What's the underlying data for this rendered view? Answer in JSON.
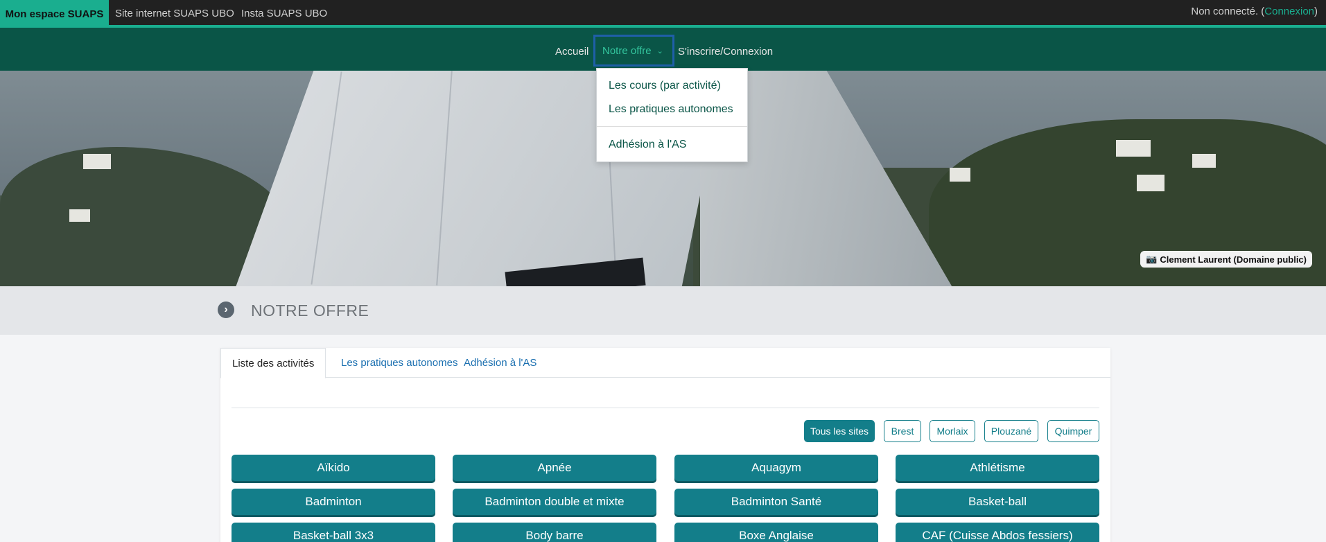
{
  "topbar": {
    "brand": "Mon espace SUAPS",
    "links": [
      "Site internet SUAPS UBO",
      "Insta SUAPS UBO"
    ],
    "status_prefix": "Non connecté. (",
    "login_label": "Connexion",
    "status_suffix": ")"
  },
  "nav": {
    "items": [
      "Accueil",
      "Notre offre",
      "S'inscrire/Connexion"
    ]
  },
  "dropdown": {
    "items": [
      "Les cours (par activité)",
      "Les pratiques autonomes",
      "Adhésion à l'AS"
    ]
  },
  "hero": {
    "credit": "Clement Laurent (Domaine public)"
  },
  "page": {
    "title": "NOTRE OFFRE"
  },
  "tabs": [
    "Liste des activités",
    "Les pratiques autonomes",
    "Adhésion à l'AS"
  ],
  "filters": [
    "Tous les sites",
    "Brest",
    "Morlaix",
    "Plouzané",
    "Quimper"
  ],
  "activities": [
    "Aïkido",
    "Apnée",
    "Aquagym",
    "Athlétisme",
    "Badminton",
    "Badminton double et mixte",
    "Badminton Santé",
    "Basket-ball",
    "Basket-ball 3x3",
    "Body barre",
    "Boxe Anglaise",
    "CAF (Cuisse Abdos fessiers)"
  ],
  "colors": {
    "brand": "#1aae8f",
    "nav": "#0a5547",
    "button": "#137e8a"
  }
}
